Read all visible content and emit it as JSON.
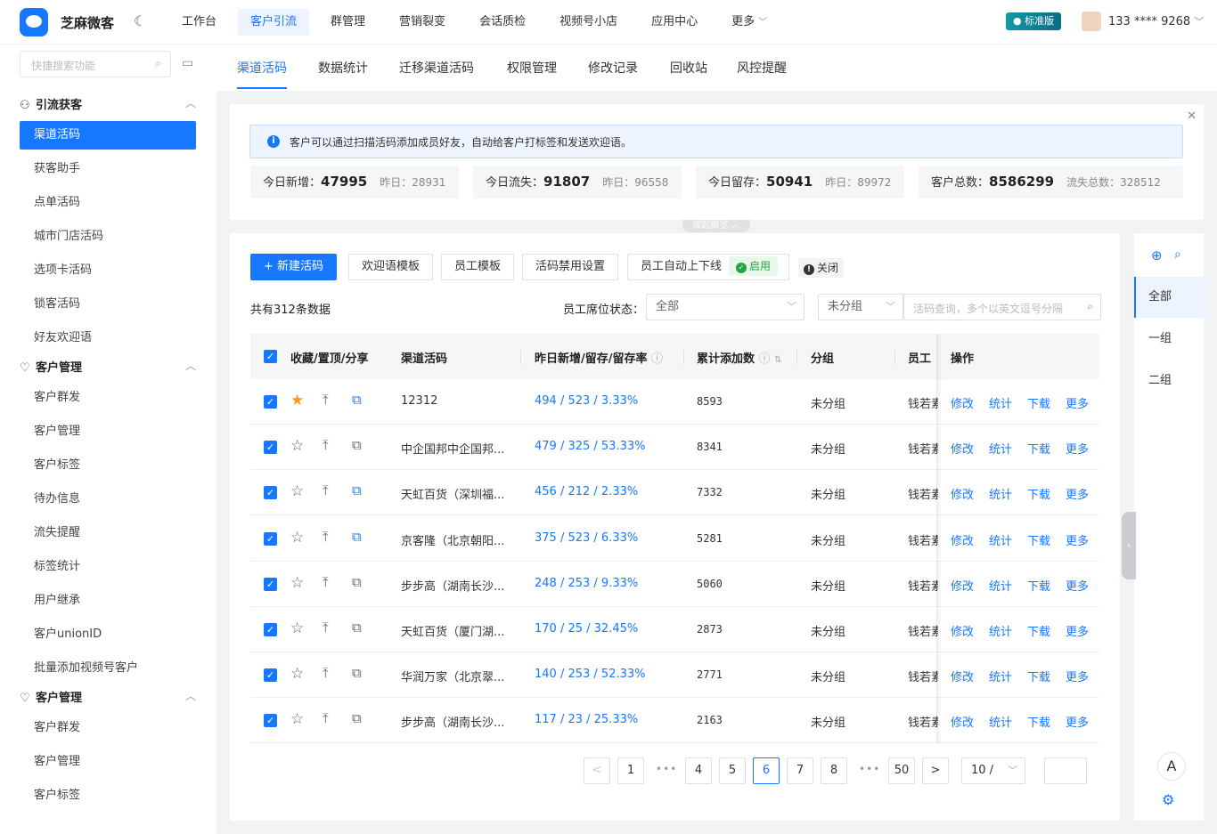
{
  "brand": {
    "name": "芝麻微客",
    "theme_icon": "moon-icon"
  },
  "topnav": [
    "工作台",
    "客户引流",
    "群管理",
    "营销裂变",
    "会话质检",
    "视频号小店",
    "应用中心",
    "更多"
  ],
  "topnav_active": 1,
  "topnav_more_icon": "chevron-down-icon",
  "account": {
    "edition": "标准版",
    "phone": "133 **** 9268"
  },
  "sidebar": {
    "search_placeholder": "快捷搜索功能",
    "groups": [
      {
        "title": "引流获客",
        "icon": "user-add-icon",
        "items": [
          "渠道活码",
          "获客助手",
          "点单活码",
          "城市门店活码",
          "选项卡活码",
          "锁客活码",
          "好友欢迎语"
        ]
      },
      {
        "title": "客户管理",
        "icon": "heart-icon",
        "items": [
          "客户群发",
          "客户管理",
          "客户标签",
          "待办信息",
          "流失提醒",
          "标签统计",
          "用户继承",
          "客户unionID",
          "批量添加视频号客户"
        ]
      },
      {
        "title": "客户管理",
        "icon": "heart-icon",
        "items": [
          "客户群发",
          "客户管理",
          "客户标签"
        ]
      }
    ]
  },
  "subtabs": [
    "渠道活码",
    "数据统计",
    "迁移渠道活码",
    "权限管理",
    "修改记录",
    "回收站",
    "风控提醒"
  ],
  "overview": {
    "info": "客户可以通过扫描活码添加成员好友，自动给客户打标签和发送欢迎语。",
    "collapse_label": "收起概览",
    "stats": [
      {
        "label": "今日新增：",
        "value": "47995",
        "sub": "昨日：28931"
      },
      {
        "label": "今日流失：",
        "value": "91807",
        "sub": "昨日：96558"
      },
      {
        "label": "今日留存：",
        "value": "50941",
        "sub": "昨日：89972"
      },
      {
        "label": "客户总数：",
        "value": "8586299",
        "sub": "流失总数：328512"
      }
    ]
  },
  "toolbar": {
    "new_button": "+ 新建活码",
    "buttons": [
      "欢迎语模板",
      "员工模板",
      "活码禁用设置"
    ],
    "auto_online": "员工自动上下线",
    "on_tag": "启用",
    "off_tag": "关闭"
  },
  "filter": {
    "total": "共有312条数据",
    "seat_label": "员工席位状态：",
    "seat_value": "全部",
    "group_value": "未分组",
    "query_placeholder": "活码查询，多个以英文逗号分隔"
  },
  "table": {
    "columns": [
      "收藏/置顶/分享",
      "渠道活码",
      "昨日新增/留存/留存率",
      "累计添加数",
      "分组",
      "员工",
      "操作"
    ],
    "ops": [
      "修改",
      "统计",
      "下载",
      "更多"
    ],
    "rows": [
      {
        "starred": true,
        "share_blue": true,
        "name": "12312",
        "rate": "494 / 523 / 3.33%",
        "total": "8593",
        "group": "未分组",
        "staff": "钱若素"
      },
      {
        "starred": false,
        "share_blue": false,
        "name": "中企国邦中企国邦...",
        "rate": "479 / 325 / 53.33%",
        "total": "8341",
        "group": "未分组",
        "staff": "钱若素"
      },
      {
        "starred": false,
        "share_blue": true,
        "name": "天虹百货（深圳福...",
        "rate": "456 / 212 / 2.33%",
        "total": "7332",
        "group": "未分组",
        "staff": "钱若素"
      },
      {
        "starred": false,
        "share_blue": true,
        "name": "京客隆（北京朝阳...",
        "rate": "375 / 523 / 6.33%",
        "total": "5281",
        "group": "未分组",
        "staff": "钱若素"
      },
      {
        "starred": false,
        "share_blue": false,
        "name": "步步高（湖南长沙...",
        "rate": "248 / 253 / 9.33%",
        "total": "5060",
        "group": "未分组",
        "staff": "钱若素"
      },
      {
        "starred": false,
        "share_blue": false,
        "name": "天虹百货（厦门湖...",
        "rate": "170 / 25 / 32.45%",
        "total": "2873",
        "group": "未分组",
        "staff": "钱若素"
      },
      {
        "starred": false,
        "share_blue": false,
        "name": "华润万家（北京翠...",
        "rate": "140 / 253 / 52.33%",
        "total": "2771",
        "group": "未分组",
        "staff": "钱若素"
      },
      {
        "starred": false,
        "share_blue": false,
        "name": "步步高（湖南长沙...",
        "rate": "117 / 23 / 25.33%",
        "total": "2163",
        "group": "未分组",
        "staff": "钱若素"
      }
    ]
  },
  "pagination": {
    "pages": [
      "1",
      "4",
      "5",
      "6",
      "7",
      "8",
      "50"
    ],
    "current": "6",
    "page_size": "10 /"
  },
  "right_panel": {
    "items": [
      "全部",
      "一组",
      "二组"
    ],
    "active": 0
  },
  "colors": {
    "primary": "#1677ff",
    "success": "#22a447",
    "star": "#f59a23"
  }
}
